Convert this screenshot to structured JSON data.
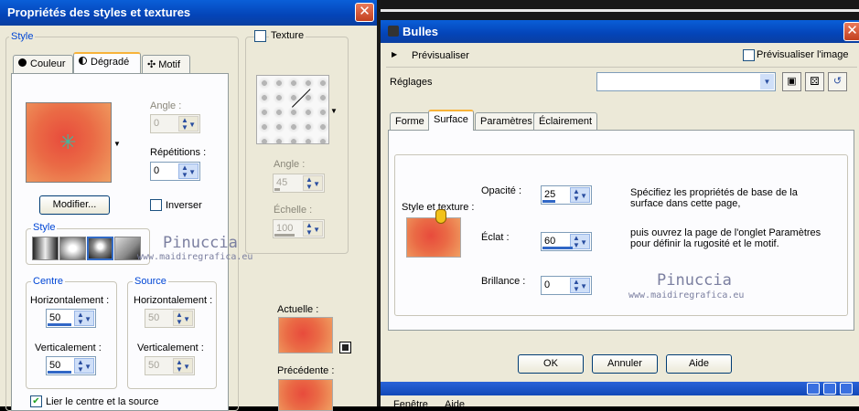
{
  "left_dialog": {
    "title": "Propriétés des styles et textures",
    "close": "✕",
    "style_group": "Style",
    "tabs": [
      "Couleur",
      "Dégradé",
      "Motif"
    ],
    "angle_label": "Angle :",
    "angle_value": "0",
    "repetitions_label": "Répétitions :",
    "repetitions_value": "0",
    "modify_button": "Modifier...",
    "invert_label": "Inverser",
    "style_sub_group": "Style",
    "centre_group": "Centre",
    "source_group": "Source",
    "h_label": "Horizontalement :",
    "v_label": "Verticalement :",
    "centre_h": "50",
    "centre_v": "50",
    "source_h": "50",
    "source_v": "50",
    "link_label": "Lier le centre et la source",
    "texture_label": "Texture",
    "tex_angle_label": "Angle :",
    "tex_angle_value": "45",
    "scale_label": "Échelle :",
    "scale_value": "100",
    "current_label": "Actuelle :",
    "previous_label": "Précédente :"
  },
  "right_dialog": {
    "title": "Bulles",
    "close": "✕",
    "preview_label": "Prévisualiser",
    "preview_image_label": "Prévisualiser l'image",
    "settings_label": "Réglages",
    "settings_value": "",
    "tabs": [
      "Forme",
      "Surface",
      "Paramètres",
      "Éclairement"
    ],
    "style_texture_label": "Style et texture :",
    "opacity_label": "Opacité :",
    "opacity_value": "25",
    "shine_label": "Éclat :",
    "shine_value": "60",
    "gloss_label": "Brillance :",
    "gloss_value": "0",
    "desc1": "Spécifiez les propriétés de base de la surface dans cette page,",
    "desc2": "puis ouvrez la page de l'onglet Paramètres pour définir la rugosité et le motif.",
    "ok": "OK",
    "cancel": "Annuler",
    "help": "Aide",
    "menu_items": [
      "Fenêtre",
      "Aide"
    ]
  },
  "watermark": {
    "name": "Pinuccia",
    "url": "www.maidiregrafica.eu"
  },
  "colors": {
    "accent": "#0046d5",
    "gradient_center": "#e84b3c",
    "gradient_edge": "#f0a062"
  }
}
